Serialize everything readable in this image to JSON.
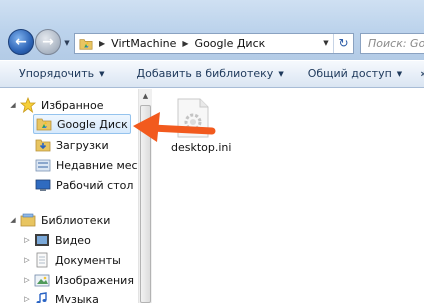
{
  "address_bar": {
    "breadcrumbs": [
      "VirtMachine",
      "Google Диск"
    ],
    "search_placeholder": "Поиск: Google Диск"
  },
  "command_bar": {
    "organize": "Упорядочить",
    "add_to_library": "Добавить в библиотеку",
    "share": "Общий доступ",
    "more": "»"
  },
  "nav_pane": {
    "favorites_label": "Избранное",
    "favorites": [
      {
        "label": "Google Диск",
        "selected": true
      },
      {
        "label": "Загрузки"
      },
      {
        "label": "Недавние места"
      },
      {
        "label": "Рабочий стол"
      }
    ],
    "libraries_label": "Библиотеки",
    "libraries": [
      {
        "label": "Видео"
      },
      {
        "label": "Документы"
      },
      {
        "label": "Изображения"
      },
      {
        "label": "Музыка"
      }
    ]
  },
  "content": {
    "files": [
      {
        "name": "desktop.ini"
      }
    ]
  },
  "colors": {
    "annotation_arrow": "#f25a1e",
    "selection_border": "#94c3ee"
  }
}
